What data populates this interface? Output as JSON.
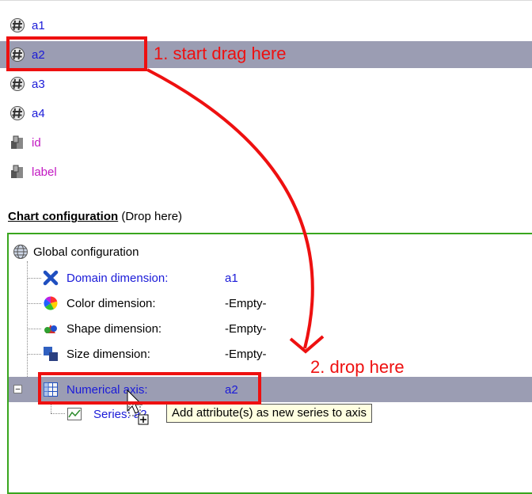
{
  "attributes": [
    {
      "label": "a1",
      "kind": "numeric",
      "color": "#1a1ad8"
    },
    {
      "label": "a2",
      "kind": "numeric",
      "color": "#1a1ad8",
      "selected": true
    },
    {
      "label": "a3",
      "kind": "numeric",
      "color": "#1a1ad8"
    },
    {
      "label": "a4",
      "kind": "numeric",
      "color": "#1a1ad8"
    },
    {
      "label": "id",
      "kind": "nominal",
      "color": "#c218c2"
    },
    {
      "label": "label",
      "kind": "nominal",
      "color": "#c218c2"
    }
  ],
  "chart_config": {
    "title": "Chart configuration",
    "hint": "(Drop here)",
    "global_label": "Global configuration",
    "domain": {
      "label": "Domain dimension:",
      "value": "a1"
    },
    "color": {
      "label": "Color dimension:",
      "value": "-Empty-"
    },
    "shape": {
      "label": "Shape dimension:",
      "value": "-Empty-"
    },
    "size": {
      "label": "Size dimension:",
      "value": "-Empty-"
    },
    "numerical_axis": {
      "label": "Numerical axis:",
      "value": "a2"
    },
    "series": {
      "label": "Series: a2"
    }
  },
  "annotations": {
    "step1": "1. start drag here",
    "step2": "2. drop here"
  },
  "tooltip": "Add attribute(s) as new series to axis",
  "colors": {
    "selection": "#9b9db3",
    "annotation": "#ee1010",
    "drop_border": "#39a61e"
  }
}
